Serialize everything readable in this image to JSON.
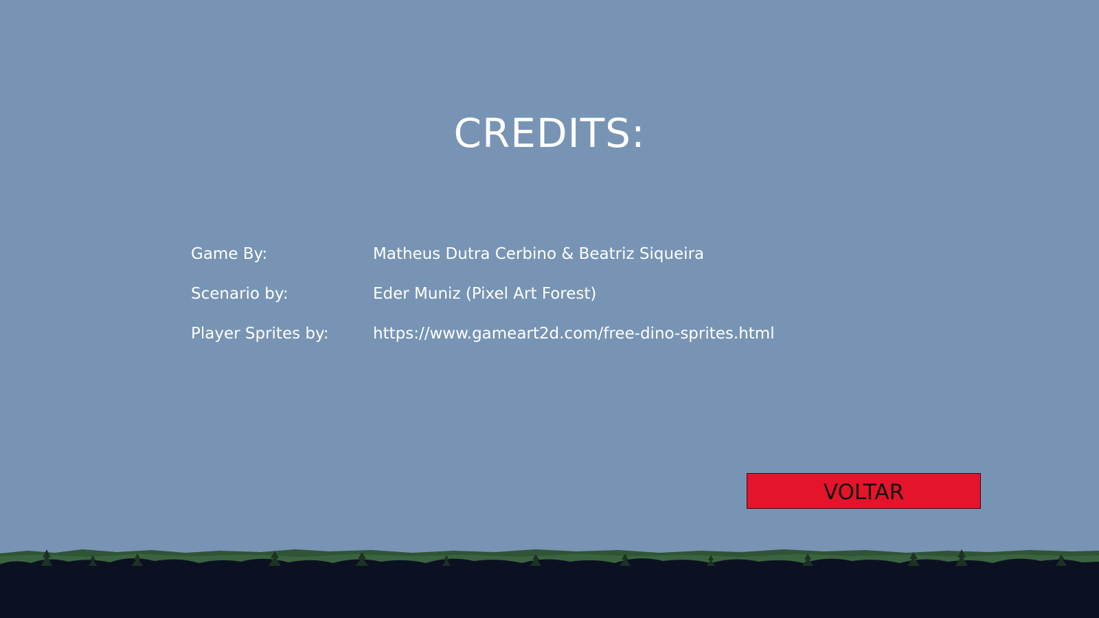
{
  "screen": {
    "title": "CREDITS:",
    "credits": [
      {
        "label": "Game By:",
        "value": "Matheus Dutra Cerbino & Beatriz Siqueira"
      },
      {
        "label": "Scenario by:",
        "value": "Eder Muniz (Pixel Art Forest)"
      },
      {
        "label": "Player Sprites by:",
        "value": "https://www.gameart2d.com/free-dino-sprites.html"
      }
    ],
    "back_button_label": "VOLTAR"
  },
  "colors": {
    "sky": "#7794b4",
    "button": "#e4142b",
    "foliage": "#2a4a2e",
    "ground": "#0c1122"
  }
}
